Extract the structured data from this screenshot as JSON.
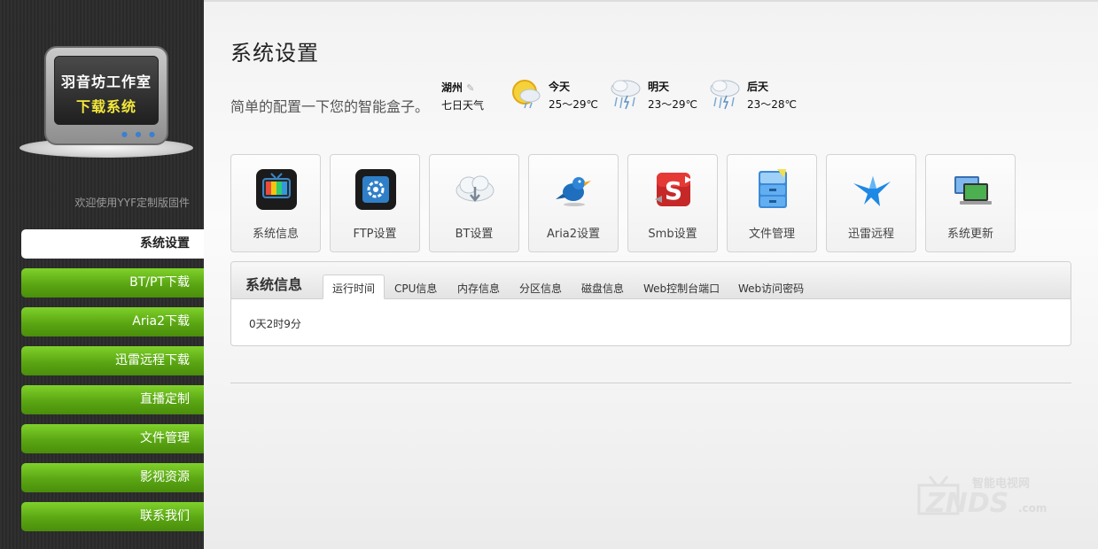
{
  "sidebar": {
    "logo": {
      "title": "羽音坊工作室",
      "subtitle": "下载系统"
    },
    "welcome": "欢迎使用YYF定制版固件",
    "items": [
      {
        "label": "系统设置",
        "active": true
      },
      {
        "label": "BT/PT下载",
        "active": false
      },
      {
        "label": "Aria2下载",
        "active": false
      },
      {
        "label": "迅雷远程下载",
        "active": false
      },
      {
        "label": "直播定制",
        "active": false
      },
      {
        "label": "文件管理",
        "active": false
      },
      {
        "label": "影视资源",
        "active": false
      },
      {
        "label": "联系我们",
        "active": false
      }
    ]
  },
  "page": {
    "title": "系统设置",
    "description": "简单的配置一下您的智能盒子。"
  },
  "weather": {
    "city": "湖州",
    "label": "七日天气",
    "days": [
      {
        "name": "今天",
        "temp": "25～29℃",
        "icon": "sun-rain-icon"
      },
      {
        "name": "明天",
        "temp": "23～29℃",
        "icon": "thunderstorm-icon"
      },
      {
        "name": "后天",
        "temp": "23～28℃",
        "icon": "thunderstorm-icon"
      }
    ]
  },
  "tiles": [
    {
      "label": "系统信息",
      "icon": "tv-icon"
    },
    {
      "label": "FTP设置",
      "icon": "gear-icon"
    },
    {
      "label": "BT设置",
      "icon": "cloud-download-icon"
    },
    {
      "label": "Aria2设置",
      "icon": "bird-icon"
    },
    {
      "label": "Smb设置",
      "icon": "smb-s-icon"
    },
    {
      "label": "文件管理",
      "icon": "file-cabinet-icon"
    },
    {
      "label": "迅雷远程",
      "icon": "thunder-bird-icon"
    },
    {
      "label": "系统更新",
      "icon": "computer-update-icon"
    }
  ],
  "panel": {
    "title": "系统信息",
    "tabs": [
      {
        "label": "运行时间",
        "active": true
      },
      {
        "label": "CPU信息",
        "active": false
      },
      {
        "label": "内存信息",
        "active": false
      },
      {
        "label": "分区信息",
        "active": false
      },
      {
        "label": "磁盘信息",
        "active": false
      },
      {
        "label": "Web控制台端口",
        "active": false
      },
      {
        "label": "Web访问密码",
        "active": false
      }
    ],
    "content": "0天2时9分"
  },
  "watermark": {
    "top": "智能电视网",
    "main": "ZNDS",
    "suffix": ".com"
  },
  "colors": {
    "sidebar_bg": "#2b2b2b",
    "nav_green": "#5aa613",
    "logo_subtitle": "#f3e83a"
  }
}
